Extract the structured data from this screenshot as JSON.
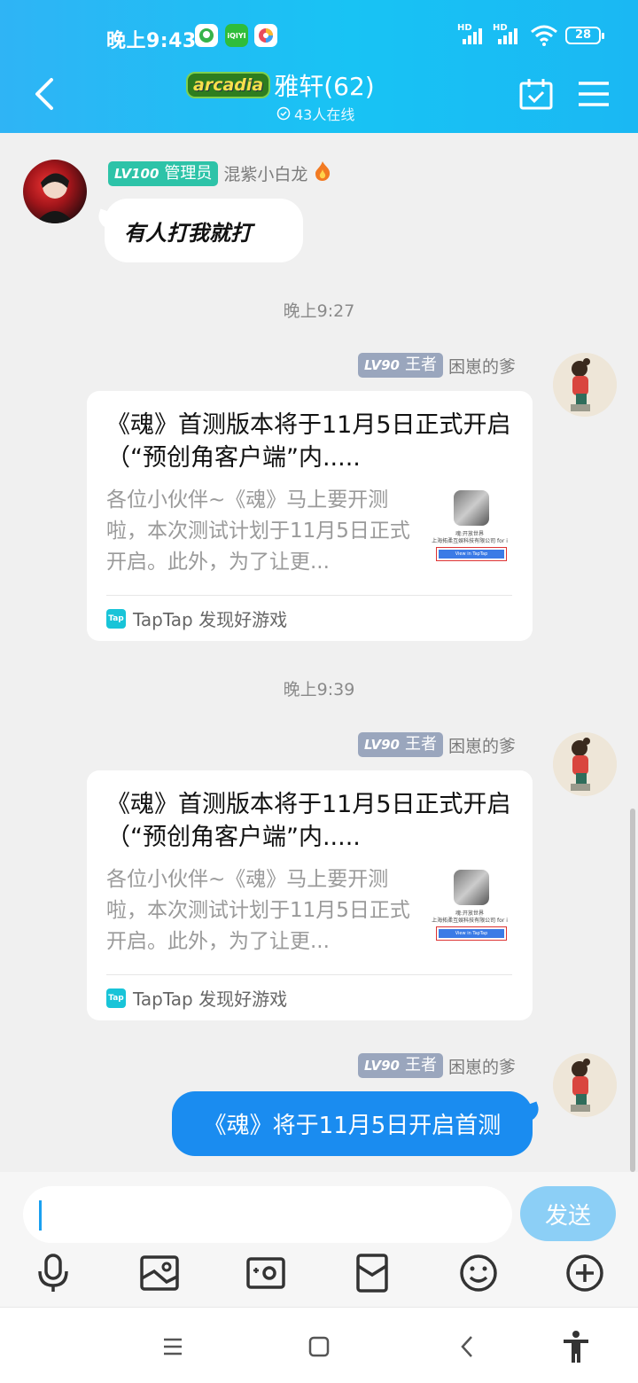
{
  "status_bar": {
    "time": "晚上9:43",
    "apps": [
      "qq-icon",
      "iqiyi-icon",
      "app-icon"
    ],
    "iqiyi_label": "iQIYI",
    "network1": "HD",
    "network2": "HD",
    "battery": "28"
  },
  "header": {
    "group_badge": "arcadia",
    "title": "雅轩(62)",
    "online": "43人在线"
  },
  "messages": [
    {
      "level": "LV100",
      "role": "管理员",
      "nick": "混紫小白龙",
      "text": "有人打我就打"
    },
    {
      "timestamp": "晚上9:27",
      "level": "LV90",
      "role": "王者",
      "nick": "困崽的爹",
      "card": {
        "title": "《魂》首测版本将于11月5日正式开启（“预创角客户端”内.....",
        "desc": "各位小伙伴~《魂》马上要开测啦，本次测试计划于11月5日正式开启。此外，为了让更...",
        "thumb_line1": "魂:开放世界",
        "thumb_line2": "上海拓柔互娱科技有限公司 for i",
        "thumb_btn": "View in TapTap",
        "source": "TapTap 发现好游戏",
        "source_icon": "Tap"
      }
    },
    {
      "timestamp": "晚上9:39",
      "level": "LV90",
      "role": "王者",
      "nick": "困崽的爹",
      "card": {
        "title": "《魂》首测版本将于11月5日正式开启（“预创角客户端”内.....",
        "desc": "各位小伙伴~《魂》马上要开测啦，本次测试计划于11月5日正式开启。此外，为了让更...",
        "thumb_line1": "魂:开放世界",
        "thumb_line2": "上海拓柔互娱科技有限公司 for i",
        "thumb_btn": "View in TapTap",
        "source": "TapTap 发现好游戏",
        "source_icon": "Tap"
      }
    },
    {
      "level": "LV90",
      "role": "王者",
      "nick": "困崽的爹",
      "text": "《魂》将于11月5日开启首测"
    }
  ],
  "composer": {
    "value": "",
    "send_label": "发送",
    "tools": [
      "microphone-icon",
      "image-icon",
      "camera-icon",
      "red-packet-icon",
      "emoji-icon",
      "plus-icon"
    ]
  },
  "colors": {
    "header": "#18c3f4",
    "bubble_blue": "#1a8cf0",
    "send_button": "#8ccff6",
    "admin_tag": "#2dc3a8",
    "king_tag": "#9aa6bd"
  }
}
